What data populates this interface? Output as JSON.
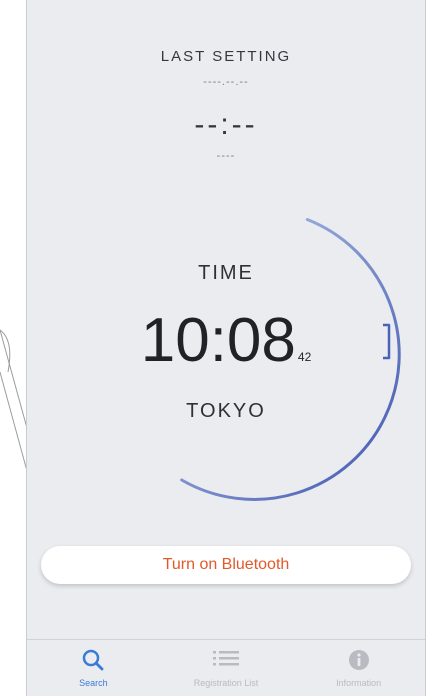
{
  "header": {
    "title": "LAST SETTING",
    "date_placeholder": "----.--.--",
    "time_placeholder": "--:--",
    "extra_placeholder": "----"
  },
  "clock": {
    "label": "TIME",
    "time": "10:08",
    "seconds": "42",
    "city": "TOKYO"
  },
  "bluetooth_button": {
    "label": "Turn on Bluetooth"
  },
  "tabbar": {
    "tabs": [
      {
        "label": "Search",
        "icon": "search-icon",
        "active": true
      },
      {
        "label": "Registration List",
        "icon": "list-icon",
        "active": false
      },
      {
        "label": "Information",
        "icon": "info-icon",
        "active": false
      }
    ]
  },
  "colors": {
    "accent": "#3a7bd5",
    "bluetooth_text": "#e05a2b",
    "dial_light": "#a9bfe3",
    "dial_dark": "#4a63b8"
  }
}
